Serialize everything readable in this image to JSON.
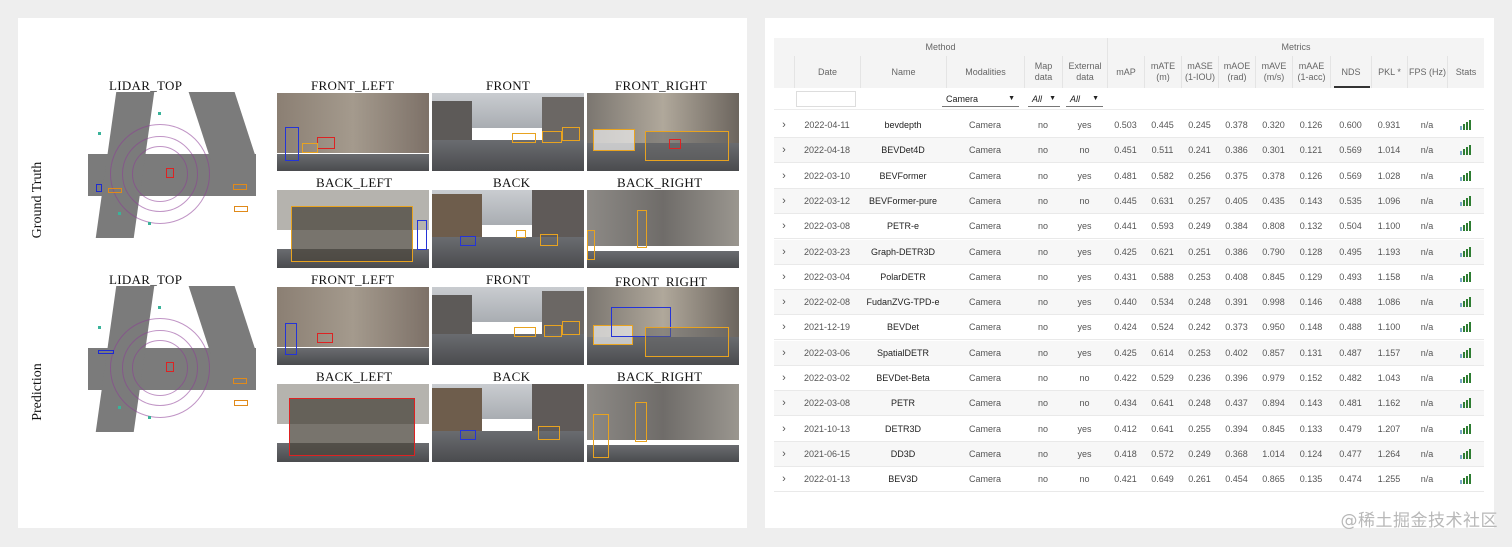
{
  "figure": {
    "row_labels": [
      "Ground Truth",
      "Prediction"
    ],
    "lidar_title": "LIDAR_TOP",
    "camera_titles": [
      "FRONT_LEFT",
      "FRONT",
      "FRONT_RIGHT",
      "BACK_LEFT",
      "BACK",
      "BACK_RIGHT"
    ]
  },
  "table": {
    "groups": {
      "method": "Method",
      "metrics": "Metrics"
    },
    "columns": {
      "date": "Date",
      "name": "Name",
      "modalities": "Modalities",
      "map_data": "Map data",
      "external_data": "External data",
      "map": "mAP",
      "mate": "mATE (m)",
      "mase": "mASE (1-IOU)",
      "maoe": "mAOE (rad)",
      "mave": "mAVE (m/s)",
      "maae": "mAAE (1-acc)",
      "nds": "NDS",
      "pkl": "PKL *",
      "fps": "FPS (Hz)",
      "stats": "Stats"
    },
    "filters": {
      "date": "",
      "modalities": "Camera",
      "map_data": "All",
      "external_data": "All"
    },
    "rows": [
      {
        "date": "2022-04-11",
        "name": "bevdepth",
        "modalities": "Camera",
        "map_data": "no",
        "external_data": "yes",
        "map": "0.503",
        "mate": "0.445",
        "mase": "0.245",
        "maoe": "0.378",
        "mave": "0.320",
        "maae": "0.126",
        "nds": "0.600",
        "pkl": "0.931",
        "fps": "n/a"
      },
      {
        "date": "2022-04-18",
        "name": "BEVDet4D",
        "modalities": "Camera",
        "map_data": "no",
        "external_data": "no",
        "map": "0.451",
        "mate": "0.511",
        "mase": "0.241",
        "maoe": "0.386",
        "mave": "0.301",
        "maae": "0.121",
        "nds": "0.569",
        "pkl": "1.014",
        "fps": "n/a"
      },
      {
        "date": "2022-03-10",
        "name": "BEVFormer",
        "modalities": "Camera",
        "map_data": "no",
        "external_data": "yes",
        "map": "0.481",
        "mate": "0.582",
        "mase": "0.256",
        "maoe": "0.375",
        "mave": "0.378",
        "maae": "0.126",
        "nds": "0.569",
        "pkl": "1.028",
        "fps": "n/a"
      },
      {
        "date": "2022-03-12",
        "name": "BEVFormer-pure",
        "modalities": "Camera",
        "map_data": "no",
        "external_data": "no",
        "map": "0.445",
        "mate": "0.631",
        "mase": "0.257",
        "maoe": "0.405",
        "mave": "0.435",
        "maae": "0.143",
        "nds": "0.535",
        "pkl": "1.096",
        "fps": "n/a"
      },
      {
        "date": "2022-03-08",
        "name": "PETR-e",
        "modalities": "Camera",
        "map_data": "no",
        "external_data": "yes",
        "map": "0.441",
        "mate": "0.593",
        "mase": "0.249",
        "maoe": "0.384",
        "mave": "0.808",
        "maae": "0.132",
        "nds": "0.504",
        "pkl": "1.100",
        "fps": "n/a"
      },
      {
        "date": "2022-03-23",
        "name": "Graph-DETR3D",
        "modalities": "Camera",
        "map_data": "no",
        "external_data": "yes",
        "map": "0.425",
        "mate": "0.621",
        "mase": "0.251",
        "maoe": "0.386",
        "mave": "0.790",
        "maae": "0.128",
        "nds": "0.495",
        "pkl": "1.193",
        "fps": "n/a"
      },
      {
        "date": "2022-03-04",
        "name": "PolarDETR",
        "modalities": "Camera",
        "map_data": "no",
        "external_data": "yes",
        "map": "0.431",
        "mate": "0.588",
        "mase": "0.253",
        "maoe": "0.408",
        "mave": "0.845",
        "maae": "0.129",
        "nds": "0.493",
        "pkl": "1.158",
        "fps": "n/a"
      },
      {
        "date": "2022-02-08",
        "name": "FudanZVG-TPD-e",
        "modalities": "Camera",
        "map_data": "no",
        "external_data": "yes",
        "map": "0.440",
        "mate": "0.534",
        "mase": "0.248",
        "maoe": "0.391",
        "mave": "0.998",
        "maae": "0.146",
        "nds": "0.488",
        "pkl": "1.086",
        "fps": "n/a"
      },
      {
        "date": "2021-12-19",
        "name": "BEVDet",
        "modalities": "Camera",
        "map_data": "no",
        "external_data": "yes",
        "map": "0.424",
        "mate": "0.524",
        "mase": "0.242",
        "maoe": "0.373",
        "mave": "0.950",
        "maae": "0.148",
        "nds": "0.488",
        "pkl": "1.100",
        "fps": "n/a"
      },
      {
        "date": "2022-03-06",
        "name": "SpatialDETR",
        "modalities": "Camera",
        "map_data": "no",
        "external_data": "yes",
        "map": "0.425",
        "mate": "0.614",
        "mase": "0.253",
        "maoe": "0.402",
        "mave": "0.857",
        "maae": "0.131",
        "nds": "0.487",
        "pkl": "1.157",
        "fps": "n/a"
      },
      {
        "date": "2022-03-02",
        "name": "BEVDet-Beta",
        "modalities": "Camera",
        "map_data": "no",
        "external_data": "no",
        "map": "0.422",
        "mate": "0.529",
        "mase": "0.236",
        "maoe": "0.396",
        "mave": "0.979",
        "maae": "0.152",
        "nds": "0.482",
        "pkl": "1.043",
        "fps": "n/a"
      },
      {
        "date": "2022-03-08",
        "name": "PETR",
        "modalities": "Camera",
        "map_data": "no",
        "external_data": "no",
        "map": "0.434",
        "mate": "0.641",
        "mase": "0.248",
        "maoe": "0.437",
        "mave": "0.894",
        "maae": "0.143",
        "nds": "0.481",
        "pkl": "1.162",
        "fps": "n/a"
      },
      {
        "date": "2021-10-13",
        "name": "DETR3D",
        "modalities": "Camera",
        "map_data": "no",
        "external_data": "yes",
        "map": "0.412",
        "mate": "0.641",
        "mase": "0.255",
        "maoe": "0.394",
        "mave": "0.845",
        "maae": "0.133",
        "nds": "0.479",
        "pkl": "1.207",
        "fps": "n/a"
      },
      {
        "date": "2021-06-15",
        "name": "DD3D",
        "modalities": "Camera",
        "map_data": "no",
        "external_data": "yes",
        "map": "0.418",
        "mate": "0.572",
        "mase": "0.249",
        "maoe": "0.368",
        "mave": "1.014",
        "maae": "0.124",
        "nds": "0.477",
        "pkl": "1.264",
        "fps": "n/a"
      },
      {
        "date": "2022-01-13",
        "name": "BEV3D",
        "modalities": "Camera",
        "map_data": "no",
        "external_data": "no",
        "map": "0.421",
        "mate": "0.649",
        "mase": "0.261",
        "maoe": "0.454",
        "mave": "0.865",
        "maae": "0.135",
        "nds": "0.474",
        "pkl": "1.255",
        "fps": "n/a"
      }
    ]
  },
  "watermark": "@稀土掘金技术社区",
  "icons": {
    "expand": "chevron-right-icon",
    "stats": "bar-chart-icon",
    "dropdown": "caret-down-icon"
  },
  "colors": {
    "stats_icon": "#2e7d32",
    "gt_box": "#e8a320",
    "pred_box": "#2434d8"
  }
}
